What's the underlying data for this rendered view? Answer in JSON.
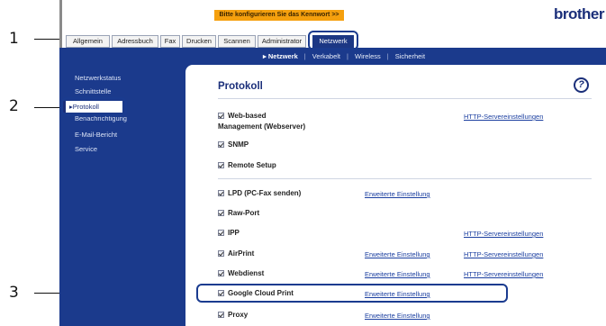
{
  "banner": {
    "text": "Bitte konfigurieren Sie das Kennwort >>"
  },
  "brand": {
    "logo": "brother"
  },
  "tabs": [
    "Allgemein",
    "Adressbuch",
    "Fax",
    "Drucken",
    "Scannen",
    "Administrator",
    "Netzwerk"
  ],
  "subnav": {
    "items": [
      "Netzwerk",
      "Verkabelt",
      "Wireless",
      "Sicherheit"
    ]
  },
  "sidebar": {
    "items": [
      "Netzwerkstatus",
      "Schnittstelle",
      "Protokoll",
      "Benachrichtigung",
      "E-Mail-Bericht",
      "Service"
    ]
  },
  "panel": {
    "title": "Protokoll",
    "help_icon": "question-icon"
  },
  "rows": [
    {
      "label": "Web-based",
      "label2": "Management (Webserver)",
      "link1": "",
      "link2": "HTTP-Servereinstellungen"
    },
    {
      "label": "SNMP",
      "link1": "",
      "link2": ""
    },
    {
      "label": "Remote Setup",
      "link1": "",
      "link2": ""
    },
    {
      "label": "LPD (PC-Fax senden)",
      "link1": "Erweiterte Einstellung",
      "link2": ""
    },
    {
      "label": "Raw-Port",
      "link1": "",
      "link2": ""
    },
    {
      "label": "IPP",
      "link1": "",
      "link2": "HTTP-Servereinstellungen"
    },
    {
      "label": "AirPrint",
      "link1": "Erweiterte Einstellung",
      "link2": "HTTP-Servereinstellungen"
    },
    {
      "label": "Webdienst",
      "link1": "Erweiterte Einstellung",
      "link2": "HTTP-Servereinstellungen"
    },
    {
      "label": "Google Cloud Print",
      "link1": "Erweiterte Einstellung",
      "link2": ""
    },
    {
      "label": "Proxy",
      "link1": "Erweiterte Einstellung",
      "link2": ""
    }
  ],
  "callouts": [
    "1",
    "2",
    "3"
  ],
  "colors": {
    "navy": "#1b3a8c",
    "banner": "#f5a00e",
    "logo": "#1b2f7a"
  }
}
